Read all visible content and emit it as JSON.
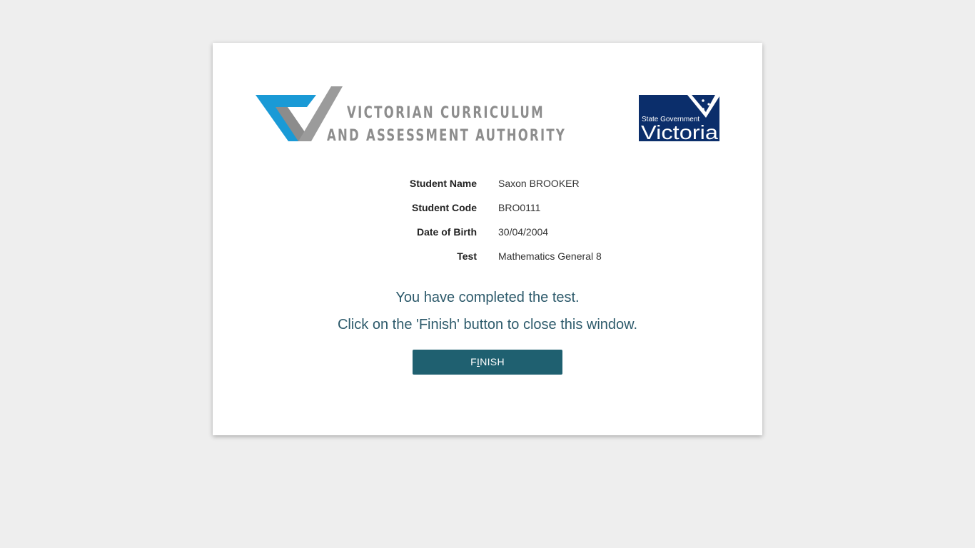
{
  "header": {
    "vcaa_logo": {
      "line1": "VICTORIAN CURRICULUM",
      "line2": "AND ASSESSMENT AUTHORITY",
      "colors": {
        "blue": "#1a9ad6",
        "grey": "#9b9b9b"
      }
    },
    "vic_logo": {
      "small_text": "State Government",
      "large_text": "Victoria",
      "background": "#0b2e6b"
    }
  },
  "student_info": [
    {
      "label": "Student Name",
      "value": "Saxon BROOKER"
    },
    {
      "label": "Student Code",
      "value": "BRO0111"
    },
    {
      "label": "Date of Birth",
      "value": "30/04/2004"
    },
    {
      "label": "Test",
      "value": "Mathematics General 8"
    }
  ],
  "messages": {
    "completed": "You have completed the test.",
    "instruction": "Click on the 'Finish' button to close this window."
  },
  "finish_button": {
    "label_prefix": "F",
    "label_underlined": "I",
    "label_suffix": "NISH",
    "color": "#1f6070"
  }
}
